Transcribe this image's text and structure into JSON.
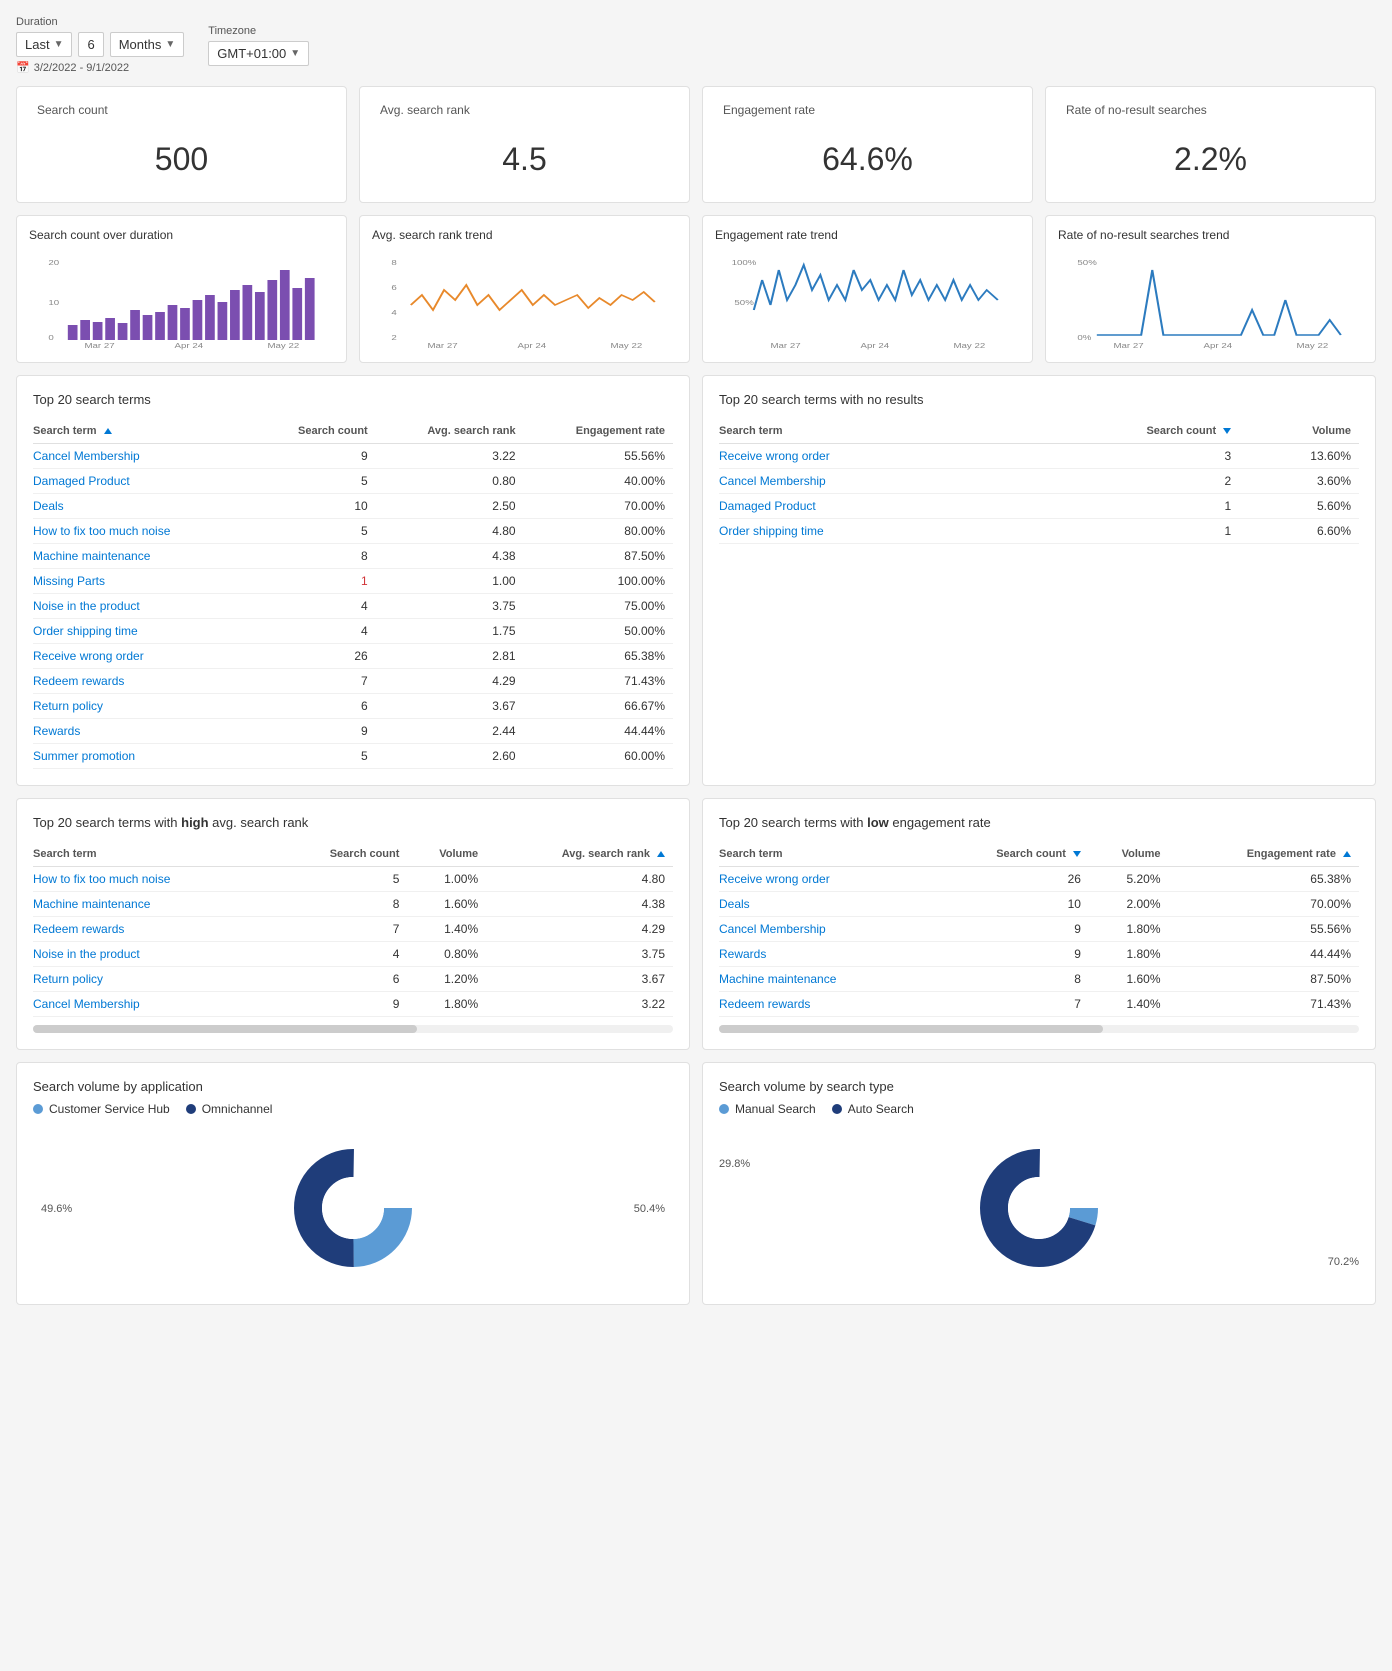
{
  "header": {
    "duration_label": "Duration",
    "timezone_label": "Timezone",
    "last_label": "Last",
    "duration_value": "6",
    "months_label": "Months",
    "timezone_value": "GMT+01:00",
    "date_range_icon": "📅",
    "date_range": "3/2/2022 - 9/1/2022"
  },
  "summary_cards": [
    {
      "title": "Search count",
      "value": "500"
    },
    {
      "title": "Avg. search rank",
      "value": "4.5"
    },
    {
      "title": "Engagement rate",
      "value": "64.6%"
    },
    {
      "title": "Rate of no-result searches",
      "value": "2.2%"
    }
  ],
  "chart_cards": [
    {
      "title": "Search count over duration",
      "color": "#7b4eb0"
    },
    {
      "title": "Avg. search rank trend",
      "color": "#e8892b"
    },
    {
      "title": "Engagement rate trend",
      "color": "#2c7bbf"
    },
    {
      "title": "Rate of no-result searches trend",
      "color": "#2c7bbf"
    }
  ],
  "top20_table": {
    "title": "Top 20 search terms",
    "columns": [
      "Search term",
      "Search count",
      "Avg. search rank",
      "Engagement rate"
    ],
    "rows": [
      [
        "Cancel Membership",
        "9",
        "3.22",
        "55.56%"
      ],
      [
        "Damaged Product",
        "5",
        "0.80",
        "40.00%"
      ],
      [
        "Deals",
        "10",
        "2.50",
        "70.00%"
      ],
      [
        "How to fix too much noise",
        "5",
        "4.80",
        "80.00%"
      ],
      [
        "Machine maintenance",
        "8",
        "4.38",
        "87.50%"
      ],
      [
        "Missing Parts",
        "1",
        "1.00",
        "100.00%"
      ],
      [
        "Noise in the product",
        "4",
        "3.75",
        "75.00%"
      ],
      [
        "Order shipping time",
        "4",
        "1.75",
        "50.00%"
      ],
      [
        "Receive wrong order",
        "26",
        "2.81",
        "65.38%"
      ],
      [
        "Redeem rewards",
        "7",
        "4.29",
        "71.43%"
      ],
      [
        "Return policy",
        "6",
        "3.67",
        "66.67%"
      ],
      [
        "Rewards",
        "9",
        "2.44",
        "44.44%"
      ],
      [
        "Summer promotion",
        "5",
        "2.60",
        "60.00%"
      ]
    ]
  },
  "no_results_table": {
    "title": "Top 20 search terms with no results",
    "columns": [
      "Search term",
      "Search count",
      "Volume"
    ],
    "rows": [
      [
        "Receive wrong order",
        "3",
        "13.60%"
      ],
      [
        "Cancel Membership",
        "2",
        "3.60%"
      ],
      [
        "Damaged Product",
        "1",
        "5.60%"
      ],
      [
        "Order shipping time",
        "1",
        "6.60%"
      ]
    ]
  },
  "high_rank_table": {
    "title": "Top 20 search terms with high avg. search rank",
    "columns": [
      "Search term",
      "Search count",
      "Volume",
      "Avg. search rank"
    ],
    "rows": [
      [
        "How to fix too much noise",
        "5",
        "1.00%",
        "4.80"
      ],
      [
        "Machine maintenance",
        "8",
        "1.60%",
        "4.38"
      ],
      [
        "Redeem rewards",
        "7",
        "1.40%",
        "4.29"
      ],
      [
        "Noise in the product",
        "4",
        "0.80%",
        "3.75"
      ],
      [
        "Return policy",
        "6",
        "1.20%",
        "3.67"
      ],
      [
        "Cancel Membership",
        "9",
        "1.80%",
        "3.22"
      ]
    ]
  },
  "low_engagement_table": {
    "title": "Top 20 search terms with low engagement rate",
    "columns": [
      "Search term",
      "Search count",
      "Volume",
      "Engagement rate"
    ],
    "rows": [
      [
        "Receive wrong order",
        "26",
        "5.20%",
        "65.38%"
      ],
      [
        "Deals",
        "10",
        "2.00%",
        "70.00%"
      ],
      [
        "Cancel Membership",
        "9",
        "1.80%",
        "55.56%"
      ],
      [
        "Rewards",
        "9",
        "1.80%",
        "44.44%"
      ],
      [
        "Machine maintenance",
        "8",
        "1.60%",
        "87.50%"
      ],
      [
        "Redeem rewards",
        "7",
        "1.40%",
        "71.43%"
      ]
    ]
  },
  "pie_application": {
    "title": "Search volume by application",
    "legend": [
      {
        "label": "Customer Service Hub",
        "color": "#5b9bd5"
      },
      {
        "label": "Omnichannel",
        "color": "#1f3d7a"
      }
    ],
    "segments": [
      {
        "label": "49.6%",
        "value": 49.6,
        "color": "#5b9bd5"
      },
      {
        "label": "50.4%",
        "value": 50.4,
        "color": "#1f3d7a"
      }
    ]
  },
  "pie_search_type": {
    "title": "Search volume by search type",
    "legend": [
      {
        "label": "Manual Search",
        "color": "#5b9bd5"
      },
      {
        "label": "Auto Search",
        "color": "#1f3d7a"
      }
    ],
    "segments": [
      {
        "label": "29.8%",
        "value": 29.8,
        "color": "#5b9bd5"
      },
      {
        "label": "70.2%",
        "value": 70.2,
        "color": "#1f3d7a"
      }
    ]
  },
  "x_axis_labels": [
    "Mar 27",
    "Apr 24",
    "May 22"
  ],
  "chart1_y_labels": [
    "0",
    "10",
    "20"
  ],
  "chart2_y_labels": [
    "2",
    "4",
    "6",
    "8"
  ],
  "chart3_y_labels": [
    "50%",
    "100%"
  ],
  "chart4_y_labels": [
    "0%",
    "50%"
  ]
}
